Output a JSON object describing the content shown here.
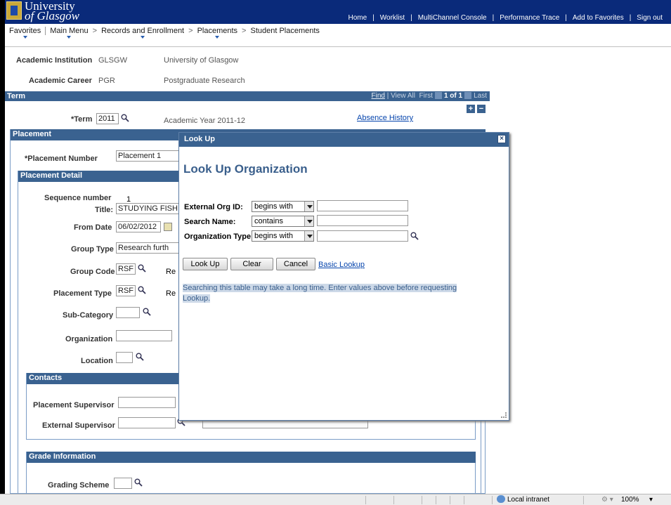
{
  "header": {
    "logo_line1": "University",
    "logo_line2": "of Glasgow",
    "nav": [
      "Home",
      "Worklist",
      "MultiChannel Console",
      "Performance Trace",
      "Add to Favorites",
      "Sign out"
    ]
  },
  "breadcrumb": [
    "Favorites",
    "Main Menu",
    "Records and Enrollment",
    "Placements",
    "Student Placements"
  ],
  "page": {
    "inst_label": "Academic Institution",
    "inst_code": "GLSGW",
    "inst_name": "University of Glasgow",
    "career_label": "Academic Career",
    "career_code": "PGR",
    "career_name": "Postgraduate Research",
    "term_bar": "Term",
    "term_nav": {
      "find": "Find",
      "view_all": "View All",
      "first": "First",
      "count": "1 of 1",
      "last": "Last"
    },
    "term_label": "*Term",
    "term_value": "2011",
    "term_desc": "Academic Year 2011-12",
    "absence_link": "Absence History",
    "placement_bar": "Placement",
    "placement_num_label": "*Placement Number",
    "placement_num_value": "Placement 1",
    "detail_bar": "Placement Detail",
    "seq_label": "Sequence number",
    "seq_value": "1",
    "title_label": "Title:",
    "title_value": "STUDYING FISH",
    "from_label": "From Date",
    "from_value": "06/02/2012",
    "group_type_label": "Group Type",
    "group_type_value": "Research furth",
    "group_code_label": "Group Code",
    "group_code_value": "RSF",
    "group_code_trail": "Re",
    "ptype_label": "Placement Type",
    "ptype_value": "RSF",
    "ptype_trail": "Re",
    "subcat_label": "Sub-Category",
    "org_label": "Organization",
    "loc_label": "Location",
    "contacts_bar": "Contacts",
    "psup_label": "Placement Supervisor",
    "esup_label": "External Supervisor",
    "grade_bar": "Grade Information",
    "scheme_label": "Grading Scheme"
  },
  "modal": {
    "header": "Look Up",
    "title": "Look Up Organization",
    "rows": [
      {
        "label": "External Org ID:",
        "op": "begins with",
        "value": ""
      },
      {
        "label": "Search Name:",
        "op": "contains",
        "value": ""
      },
      {
        "label": "Organization Type:",
        "op": "begins with",
        "value": ""
      }
    ],
    "btn_lookup": "Look Up",
    "btn_clear": "Clear",
    "btn_cancel": "Cancel",
    "basic_link": "Basic Lookup",
    "note": "Searching this table may take a long time. Enter values above before requesting Lookup."
  },
  "status": {
    "zone": "Local intranet",
    "zoom": "100%"
  }
}
